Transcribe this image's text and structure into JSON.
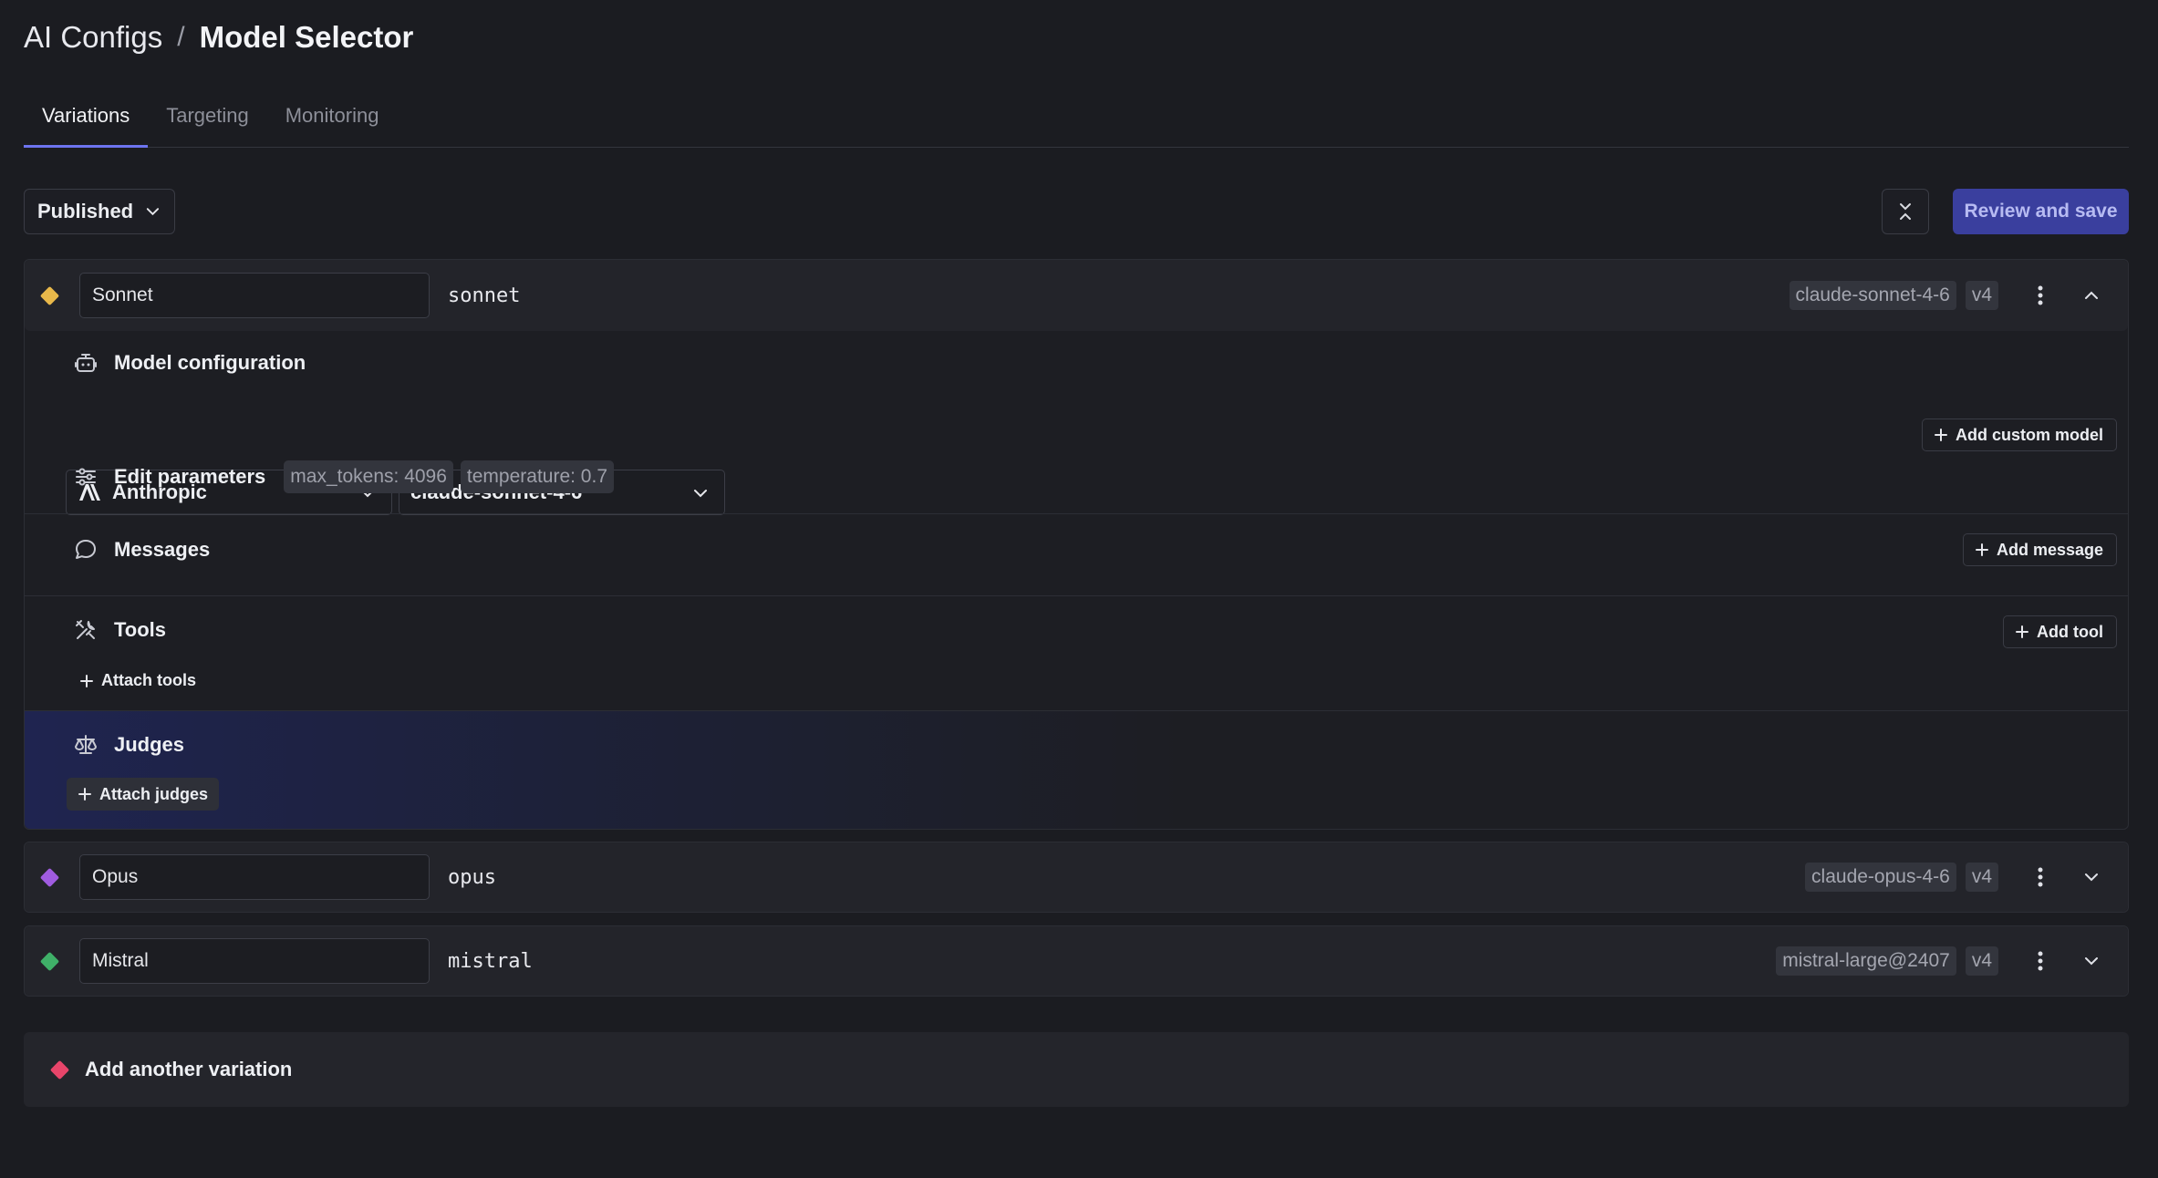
{
  "breadcrumb": {
    "parent": "AI Configs",
    "separator": "/",
    "current": "Model Selector"
  },
  "tabs": [
    {
      "label": "Variations",
      "active": true
    },
    {
      "label": "Targeting",
      "active": false
    },
    {
      "label": "Monitoring",
      "active": false
    }
  ],
  "toolbar": {
    "status": "Published",
    "save_label": "Review and save"
  },
  "variations": [
    {
      "name": "Sonnet",
      "key": "sonnet",
      "model_tag": "claude-sonnet-4-6",
      "version": "v4",
      "color": "#e8b84a",
      "expanded": true,
      "model_configuration": {
        "title": "Model configuration",
        "add_custom_model_label": "Add custom model",
        "provider": "Anthropic",
        "model": "claude-sonnet-4-6",
        "edit_parameters_label": "Edit parameters",
        "parameters": [
          "max_tokens: 4096",
          "temperature: 0.7"
        ]
      },
      "messages": {
        "title": "Messages",
        "add_label": "Add message"
      },
      "tools": {
        "title": "Tools",
        "add_label": "Add tool",
        "attach_label": "Attach tools"
      },
      "judges": {
        "title": "Judges",
        "attach_label": "Attach judges"
      }
    },
    {
      "name": "Opus",
      "key": "opus",
      "model_tag": "claude-opus-4-6",
      "version": "v4",
      "color": "#a05ce0",
      "expanded": false
    },
    {
      "name": "Mistral",
      "key": "mistral",
      "model_tag": "mistral-large@2407",
      "version": "v4",
      "color": "#3fb068",
      "expanded": false
    }
  ],
  "add_variation": {
    "label": "Add another variation",
    "color": "#e8456a"
  }
}
